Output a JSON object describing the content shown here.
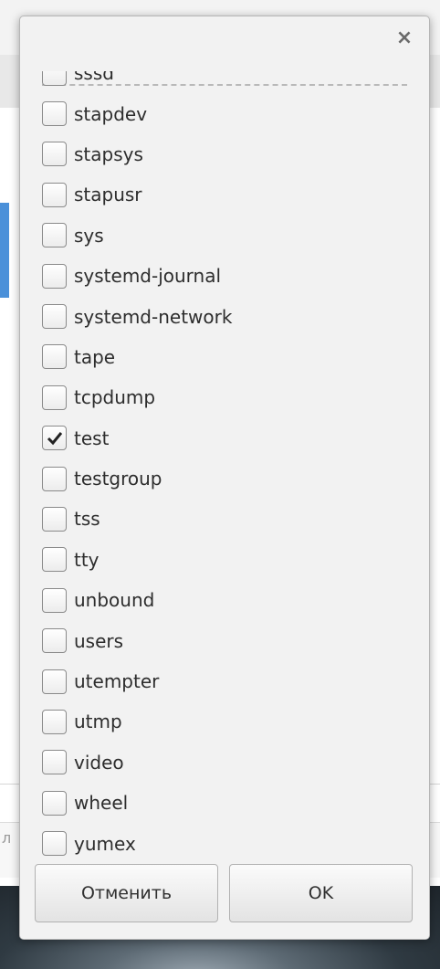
{
  "dialog": {
    "close_glyph": "×",
    "partial_item": "sssd",
    "items": [
      {
        "label": "stapdev",
        "checked": false
      },
      {
        "label": "stapsys",
        "checked": false
      },
      {
        "label": "stapusr",
        "checked": false
      },
      {
        "label": "sys",
        "checked": false
      },
      {
        "label": "systemd-journal",
        "checked": false
      },
      {
        "label": "systemd-network",
        "checked": false
      },
      {
        "label": "tape",
        "checked": false
      },
      {
        "label": "tcpdump",
        "checked": false
      },
      {
        "label": "test",
        "checked": true
      },
      {
        "label": "testgroup",
        "checked": false
      },
      {
        "label": "tss",
        "checked": false
      },
      {
        "label": "tty",
        "checked": false
      },
      {
        "label": "unbound",
        "checked": false
      },
      {
        "label": "users",
        "checked": false
      },
      {
        "label": "utempter",
        "checked": false
      },
      {
        "label": "utmp",
        "checked": false
      },
      {
        "label": "video",
        "checked": false
      },
      {
        "label": "wheel",
        "checked": false
      },
      {
        "label": "yumex",
        "checked": false
      }
    ],
    "buttons": {
      "cancel_label": "Отменить",
      "ok_label": "OK"
    }
  },
  "background": {
    "row_text": "л"
  },
  "colors": {
    "accent_blue": "#4a90d9",
    "checkmark": "#222222"
  }
}
